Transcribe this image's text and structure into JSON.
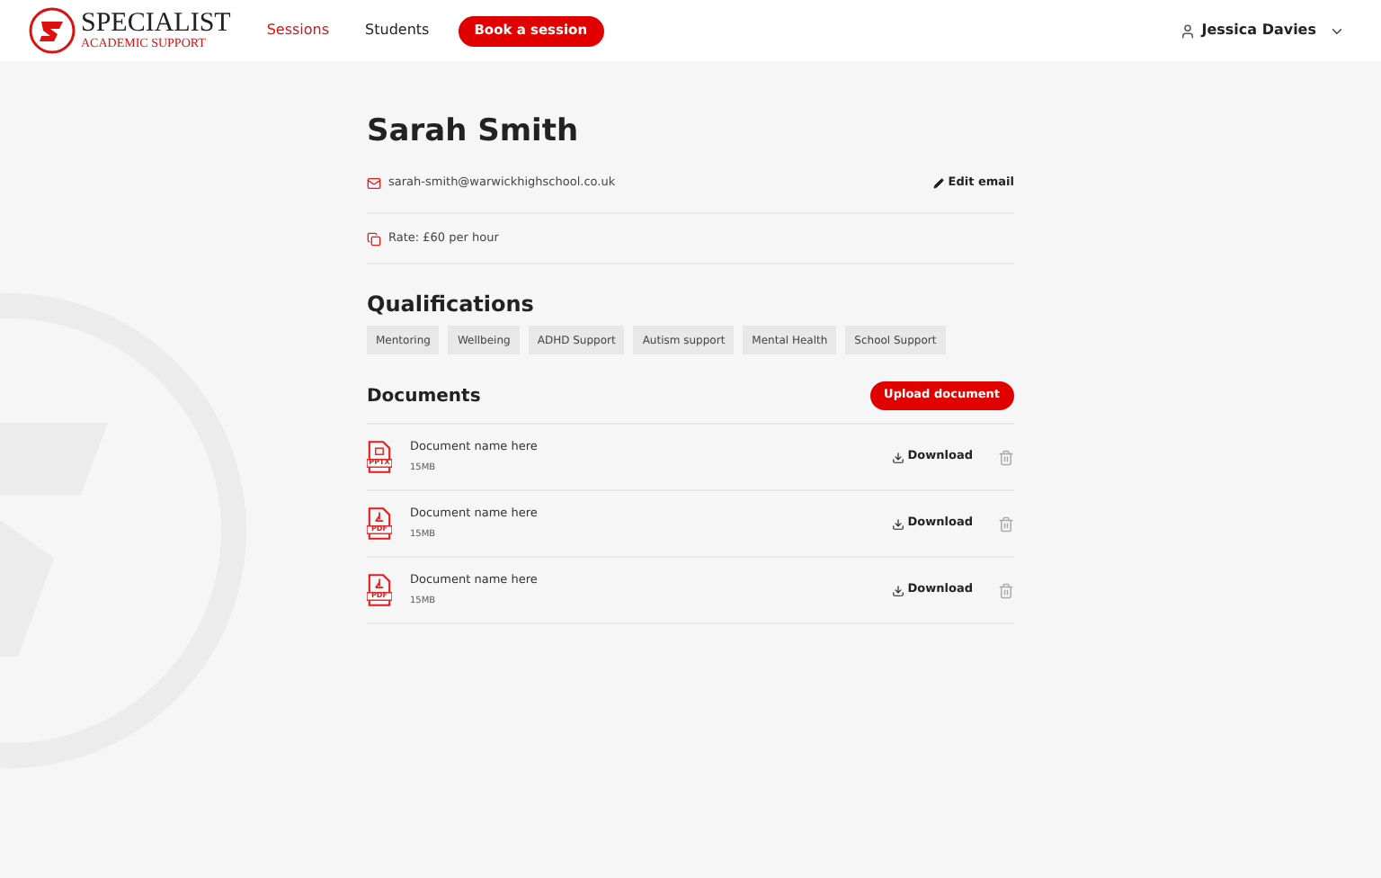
{
  "header": {
    "logo": {
      "title": "SPECIALIST",
      "subtitle": "ACADEMIC SUPPORT"
    },
    "nav": [
      {
        "label": "Sessions",
        "selected": true
      },
      {
        "label": "Students",
        "selected": false
      }
    ],
    "book_button": "Book a session",
    "user": "Jessica Davies"
  },
  "profile": {
    "name": "Sarah Smith",
    "email": "sarah-smith@warwickhighschool.co.uk",
    "edit_email": "Edit email",
    "rate": "Rate: £60 per hour"
  },
  "qualifications": {
    "title": "Qualifications",
    "tags": [
      "Mentoring",
      "Wellbeing",
      "ADHD Support",
      "Autism support",
      "Mental Health",
      "School Support"
    ]
  },
  "documents": {
    "title": "Documents",
    "upload_button": "Upload document",
    "items": [
      {
        "kind": "pptx",
        "type_label": "PPTX",
        "name": "Document name here",
        "size": "15MB",
        "download": "Download"
      },
      {
        "kind": "pdf",
        "type_label": "PDF",
        "name": "Document name here",
        "size": "15MB",
        "download": "Download"
      },
      {
        "kind": "pdf",
        "type_label": "PDF",
        "name": "Document name here",
        "size": "15MB",
        "download": "Download"
      }
    ]
  }
}
